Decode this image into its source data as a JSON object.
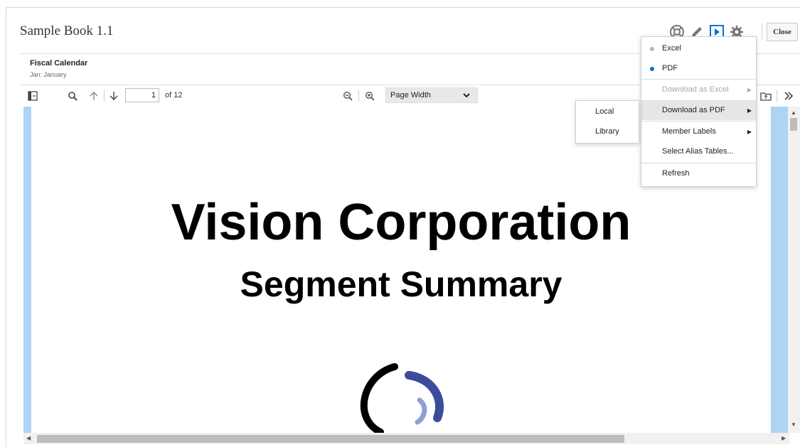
{
  "header": {
    "title": "Sample Book 1.1",
    "close_label": "Close"
  },
  "pov": {
    "title": "Fiscal Calendar",
    "subtitle": "Jan: January"
  },
  "toolbar": {
    "page_value": "1",
    "page_total": "of 12",
    "zoom_selected": "Page Width"
  },
  "document": {
    "title": "Vision Corporation",
    "subtitle": "Segment Summary"
  },
  "menu": {
    "items": [
      {
        "label": "Excel",
        "type": "radio",
        "selected": false
      },
      {
        "label": "PDF",
        "type": "radio",
        "selected": true
      },
      {
        "label": "Download as Excel",
        "disabled": true,
        "submenu": true
      },
      {
        "label": "Download as PDF",
        "highlighted": true,
        "submenu": true
      },
      {
        "label": "Member Labels",
        "submenu": true
      },
      {
        "label": "Select Alias Tables..."
      },
      {
        "label": "Refresh"
      }
    ]
  },
  "submenu": {
    "items": [
      {
        "label": "Local"
      },
      {
        "label": "Library"
      }
    ]
  },
  "icons": [
    "help-lifesaver-icon",
    "edit-pencil-icon",
    "run-play-icon",
    "settings-gear-icon",
    "toggle-panel-icon",
    "search-icon",
    "arrow-up-icon",
    "arrow-down-icon",
    "zoom-out-icon",
    "zoom-in-icon",
    "open-folder-icon",
    "overflow-chevrons-icon"
  ],
  "colors": {
    "accent": "#0572ce",
    "viewer_bg": "#aed3f3",
    "menu_highlight": "#e6e6e6"
  }
}
